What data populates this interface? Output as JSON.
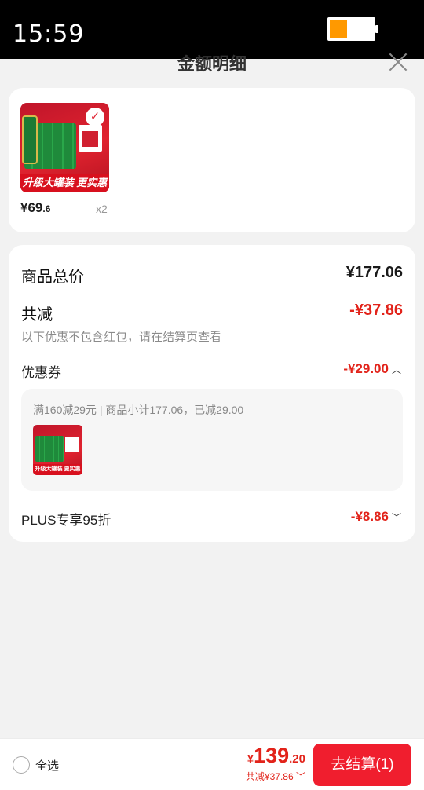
{
  "status_bar": {
    "time": "15:59",
    "battery_level": 0.4,
    "battery_color": "#ff9900"
  },
  "sheet": {
    "title": "金额明细"
  },
  "products": [
    {
      "banner": "升级大罐装 更实惠",
      "price_int": "¥69",
      "price_dec": ".6",
      "quantity": "x2"
    }
  ],
  "summary": {
    "total_label": "商品总价",
    "total_value": "¥177.06",
    "discount_label": "共减",
    "discount_value": "-¥37.86",
    "discount_note": "以下优惠不包含红包，请在结算页查看",
    "coupon_label": "优惠券",
    "coupon_value": "-¥29.00",
    "coupon_detail": "满160减29元 | 商品小计177.06，已减29.00",
    "coupon_thumb_banner": "升级大罐装 更实惠",
    "plus_label": "PLUS专享95折",
    "plus_value": "-¥8.86"
  },
  "bottom_bar": {
    "select_all_label": "全选",
    "total_currency": "¥",
    "total_int": "139",
    "total_dec": ".20",
    "savings": "共减¥37.86",
    "checkout_label": "去结算(1)"
  },
  "colors": {
    "accent_red": "#e2231a",
    "button_red": "#f01e2e",
    "background": "#f2f2f2"
  }
}
